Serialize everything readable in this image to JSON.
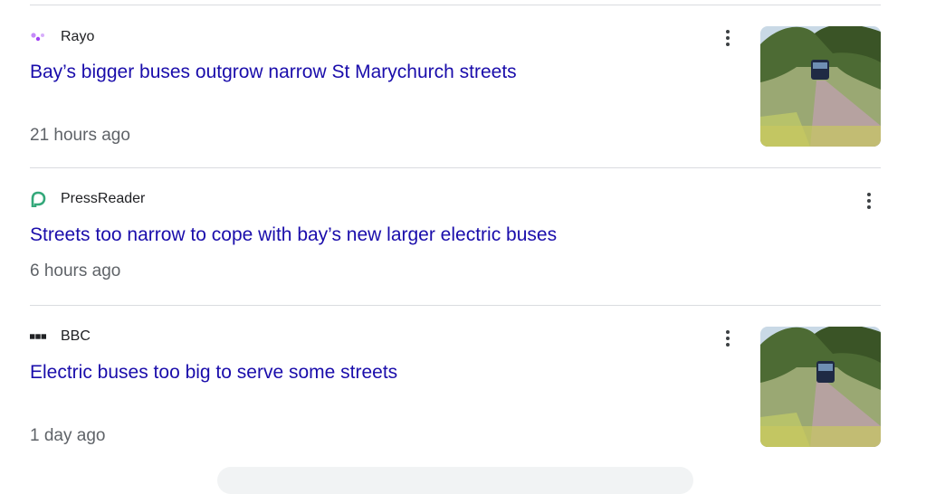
{
  "articles": [
    {
      "source": "Rayo",
      "source_logo": "rayo-logo-icon",
      "title": "Bay’s bigger buses outgrow narrow St Marychurch streets",
      "time": "21 hours ago",
      "has_thumbnail": true
    },
    {
      "source": "PressReader",
      "source_logo": "pressreader-logo-icon",
      "title": "Streets too narrow to cope with bay’s new larger electric buses",
      "time": "6 hours ago",
      "has_thumbnail": false
    },
    {
      "source": "BBC",
      "source_logo": "bbc-logo-icon",
      "title": "Electric buses too big to serve some streets",
      "time": "1 day ago",
      "has_thumbnail": true
    }
  ],
  "colors": {
    "link": "#1a0dab",
    "meta": "#5f6368",
    "source": "#202124",
    "divider": "#dadce0",
    "rayo_accent": "#a142f4",
    "pressreader_accent": "#34a87a"
  }
}
